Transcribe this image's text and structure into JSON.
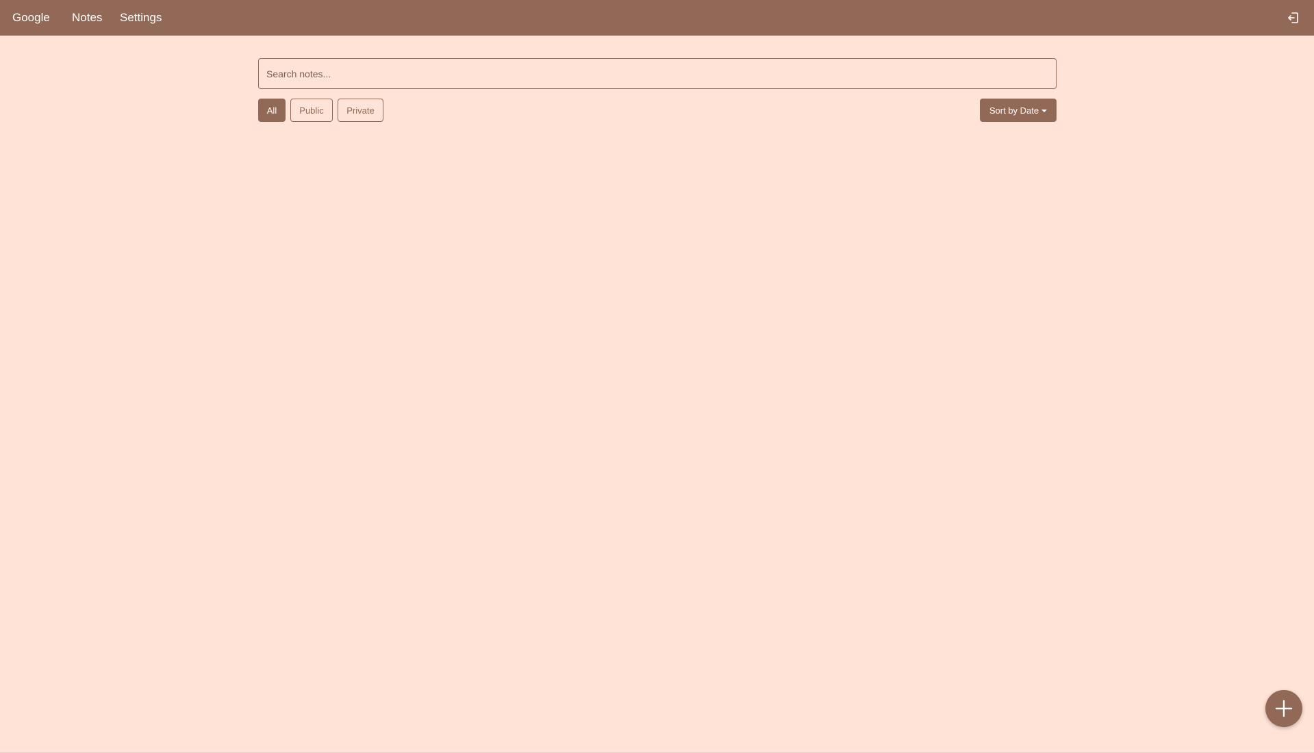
{
  "navbar": {
    "brand": "Google",
    "links": [
      {
        "label": "Notes"
      },
      {
        "label": "Settings"
      }
    ],
    "logout_icon": "logout-icon"
  },
  "search": {
    "placeholder": "Search notes...",
    "value": ""
  },
  "filters": {
    "all": "All",
    "public": "Public",
    "private": "Private",
    "active": "All"
  },
  "sort": {
    "label": "Sort by Date"
  },
  "fab": {
    "icon": "plus-icon"
  },
  "colors": {
    "primary": "#926856",
    "background": "#ffe3d7",
    "text_on_primary": "#ffffff"
  }
}
